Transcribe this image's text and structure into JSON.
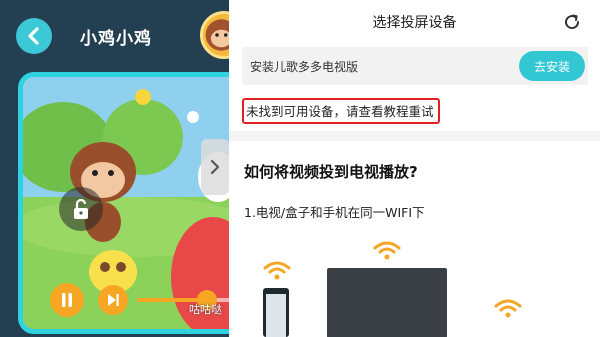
{
  "player": {
    "title": "小鸡小鸡",
    "subtitle_partial": "咕咕哒",
    "progress_fraction": 0.7
  },
  "cast_panel": {
    "title": "选择投屏设备",
    "install_prompt": "安装儿歌多多电视版",
    "install_button": "去安装",
    "error_message": "未找到可用设备，请查看教程重试",
    "howto_title": "如何将视频投到电视播放?",
    "step_1": "1.电视/盒子和手机在同一WIFI下"
  },
  "colors": {
    "accent_cyan": "#33c7d4",
    "player_orange": "#f6a623",
    "error_border": "#e02020",
    "wifi_orange": "#f6a623"
  },
  "icons": {
    "back": "arrow-left-icon",
    "lock": "unlock-icon",
    "next": "chevron-right-icon",
    "pause": "pause-icon",
    "skip": "skip-next-icon",
    "refresh": "refresh-icon",
    "wifi": "wifi-icon"
  }
}
